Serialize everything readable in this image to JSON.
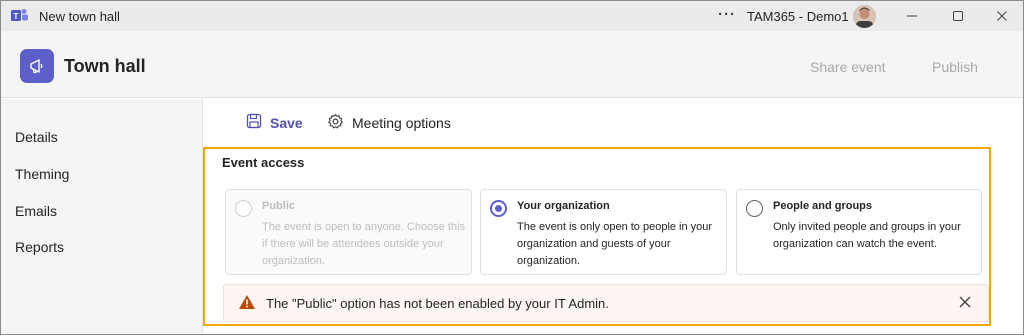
{
  "window": {
    "title": "New town hall",
    "more_label": "···",
    "account": "TAM365 - Demo1",
    "icons": {
      "app": "teams-icon",
      "minimize": "minimize-icon",
      "maximize": "maximize-icon",
      "close": "close-icon"
    }
  },
  "header": {
    "title": "Town hall",
    "share_label": "Share event",
    "publish_label": "Publish",
    "accent_color": "#5b5fc7"
  },
  "sidebar": {
    "items": [
      {
        "label": "Details"
      },
      {
        "label": "Theming"
      },
      {
        "label": "Emails"
      },
      {
        "label": "Reports"
      }
    ]
  },
  "toolbar": {
    "save_label": "Save",
    "options_label": "Meeting options"
  },
  "event_access": {
    "title": "Event access",
    "options": [
      {
        "title": "Public",
        "description": "The event is open to anyone. Choose this if there will be attendees outside your organization.",
        "selected": false,
        "disabled": true
      },
      {
        "title": "Your organization",
        "description": "The event is only open to people in your organization and guests of your organization.",
        "selected": true,
        "disabled": false
      },
      {
        "title": "People and groups",
        "description": "Only invited people and groups in your organization can watch the event.",
        "selected": false,
        "disabled": false
      }
    ]
  },
  "alert": {
    "message": "The \"Public\" option has not been enabled by your IT Admin.",
    "icon": "warning-icon",
    "close_icon": "close-icon"
  }
}
